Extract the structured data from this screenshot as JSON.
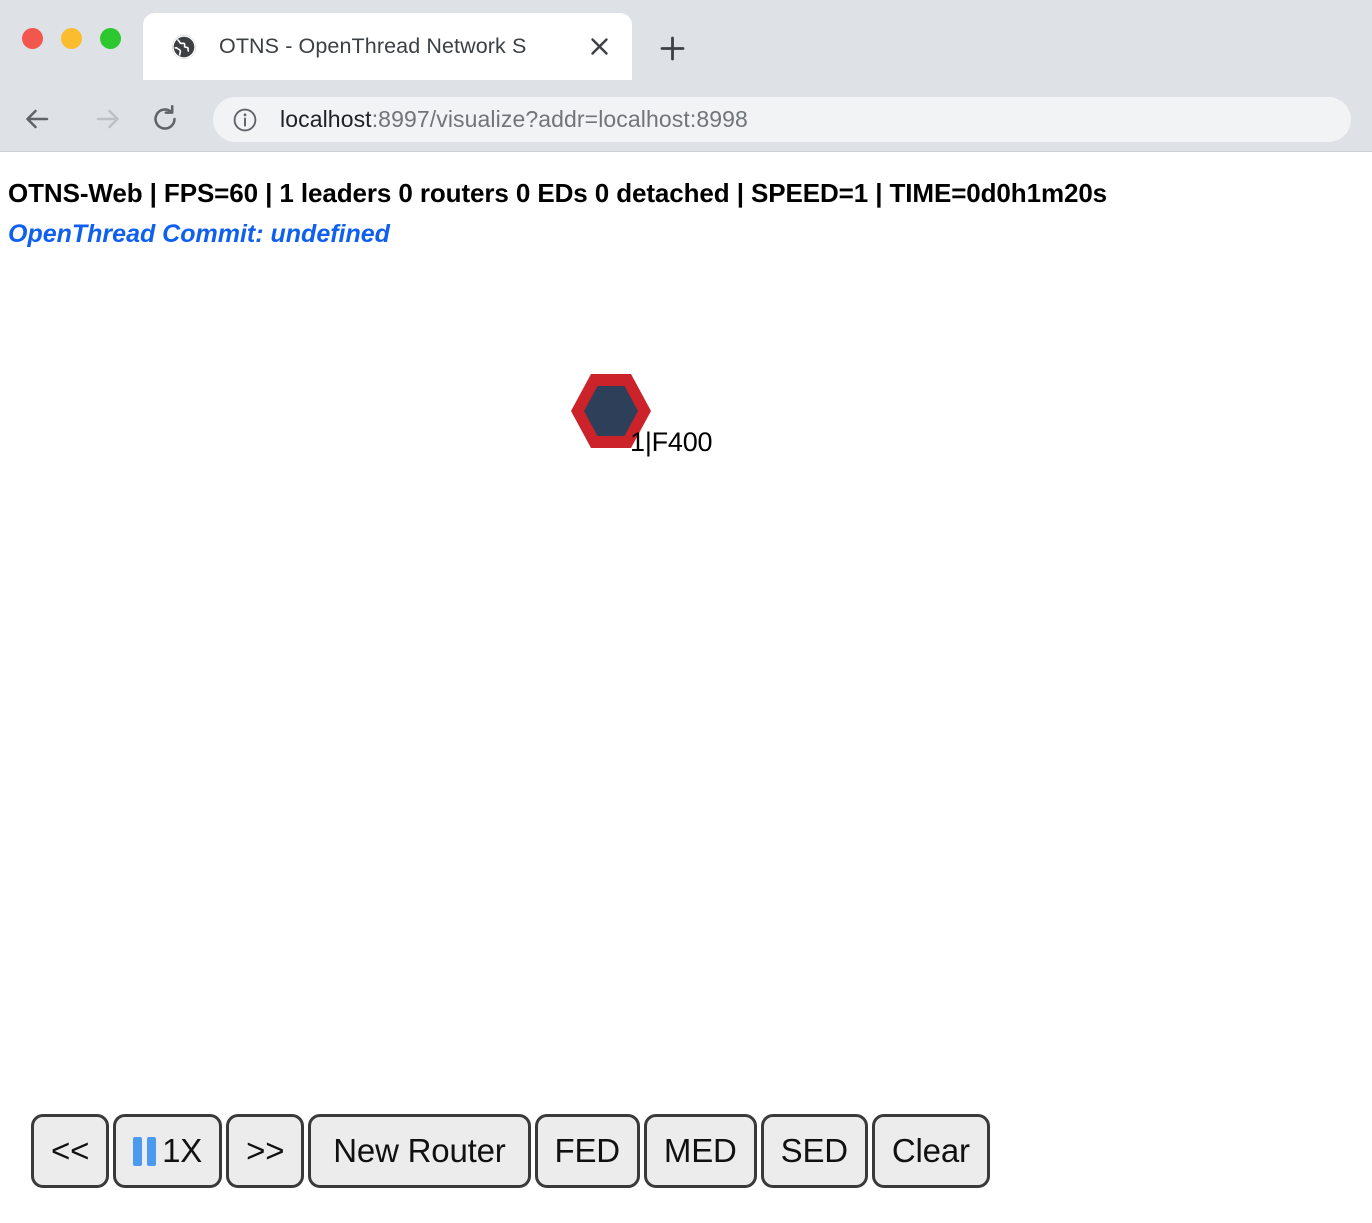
{
  "browser": {
    "window_controls": [
      {
        "name": "close",
        "color": "#f2564d"
      },
      {
        "name": "minimize",
        "color": "#fbbc2e"
      },
      {
        "name": "maximize",
        "color": "#2dc72f"
      }
    ],
    "tab": {
      "title": "OTNS - OpenThread Network S",
      "favicon": "globe-icon",
      "close_label": "×"
    },
    "new_tab_label": "+",
    "nav": {
      "back": "back-arrow-icon",
      "forward": "forward-arrow-icon",
      "reload": "reload-icon"
    },
    "omnibox": {
      "info_icon": "info-circle-icon",
      "url_host": "localhost",
      "url_rest": ":8997/visualize?addr=localhost:8998",
      "url_full": "localhost:8997/visualize?addr=localhost:8998"
    }
  },
  "page": {
    "status_line": "OTNS-Web | FPS=60 | 1 leaders 0 routers 0 EDs 0 detached | SPEED=1 | TIME=0d0h1m20s",
    "status_fields": {
      "app": "OTNS-Web",
      "fps": "FPS=60",
      "counts": "1 leaders 0 routers 0 EDs 0 detached",
      "speed": "SPEED=1",
      "time": "TIME=0d0h1m20s"
    },
    "commit_line": "OpenThread Commit: undefined",
    "colors": {
      "status_text": "#000000",
      "commit_text": "#1060f0",
      "node_ring": "#cc2229",
      "node_fill": "#2e4059",
      "pause_icon": "#4a9bf0",
      "button_face": "#ececec",
      "button_border": "#3a3a3a"
    },
    "nodes": [
      {
        "label": "1|F400",
        "id": "1",
        "rloc": "F400",
        "role": "leader",
        "ring_color": "#cc2229",
        "fill_color": "#2e4059"
      }
    ],
    "controls": [
      {
        "name": "rewind",
        "label": "<<",
        "icon": null
      },
      {
        "name": "play-pause",
        "label": "1X",
        "icon": "pause-icon"
      },
      {
        "name": "forward",
        "label": ">>",
        "icon": null
      },
      {
        "name": "new-router",
        "label": "New Router",
        "icon": null
      },
      {
        "name": "new-fed",
        "label": "FED",
        "icon": null
      },
      {
        "name": "new-med",
        "label": "MED",
        "icon": null
      },
      {
        "name": "new-sed",
        "label": "SED",
        "icon": null
      },
      {
        "name": "clear",
        "label": "Clear",
        "icon": null
      }
    ]
  }
}
